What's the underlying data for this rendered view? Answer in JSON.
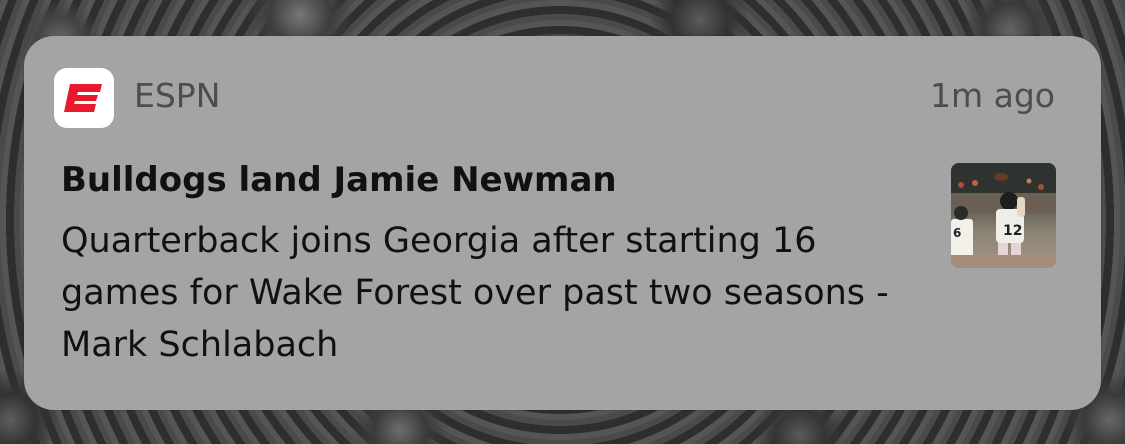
{
  "notification": {
    "app_name": "ESPN",
    "app_icon": "espn-logo-icon",
    "timestamp": "1m ago",
    "title": "Bulldogs land Jamie Newman",
    "body": "Quarterback joins Georgia after starting 16 games for Wake Forest over past two seasons - Mark Schlabach",
    "thumbnail": "football-player-photo"
  },
  "colors": {
    "card_background": "#a4a4a4",
    "espn_red": "#e8192c",
    "meta_text": "#4d4d4d",
    "primary_text": "#111111"
  }
}
